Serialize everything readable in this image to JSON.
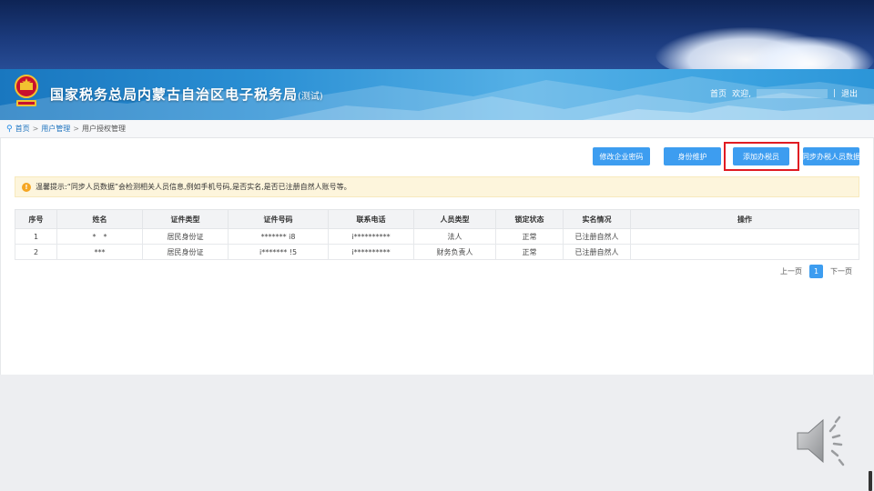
{
  "header": {
    "title": "国家税务总局内蒙古自治区电子税务局",
    "title_tag": "(测试)",
    "links": {
      "home": "首页",
      "welcome": "欢迎,",
      "separator": "|",
      "logout": "退出"
    }
  },
  "breadcrumb": {
    "home": "首页",
    "level1": "用户管理",
    "current": "用户授权管理",
    "sep": ">"
  },
  "toolbar": {
    "modify_password": "修改企业密码",
    "identity_maintain": "身份维护",
    "add_tax_officer": "添加办税员",
    "sync_tax_staff": "同步办税人员数据"
  },
  "notice": {
    "icon": "!",
    "text": "温馨提示:“同步人员数据”会检测相关人员信息,例如手机号码,是否实名,是否已注册自然人账号等。"
  },
  "table": {
    "columns": [
      "序号",
      "姓名",
      "证件类型",
      "证件号码",
      "联系电话",
      "人员类型",
      "锁定状态",
      "实名情况",
      "操作"
    ],
    "rows": [
      [
        "1",
        "*　*",
        "居民身份证",
        "*******  i8",
        "i**********",
        "法人",
        "正常",
        "已注册自然人",
        ""
      ],
      [
        "2",
        "***",
        "居民身份证",
        "i*******  !5",
        "i**********",
        "财务负责人",
        "正常",
        "已注册自然人",
        ""
      ]
    ]
  },
  "pager": {
    "prev": "上一页",
    "current": "1",
    "next": "下一页"
  },
  "colors": {
    "primary_button": "#3d9df0",
    "highlight": "#e01b22",
    "header_dark": "#0e2455"
  }
}
